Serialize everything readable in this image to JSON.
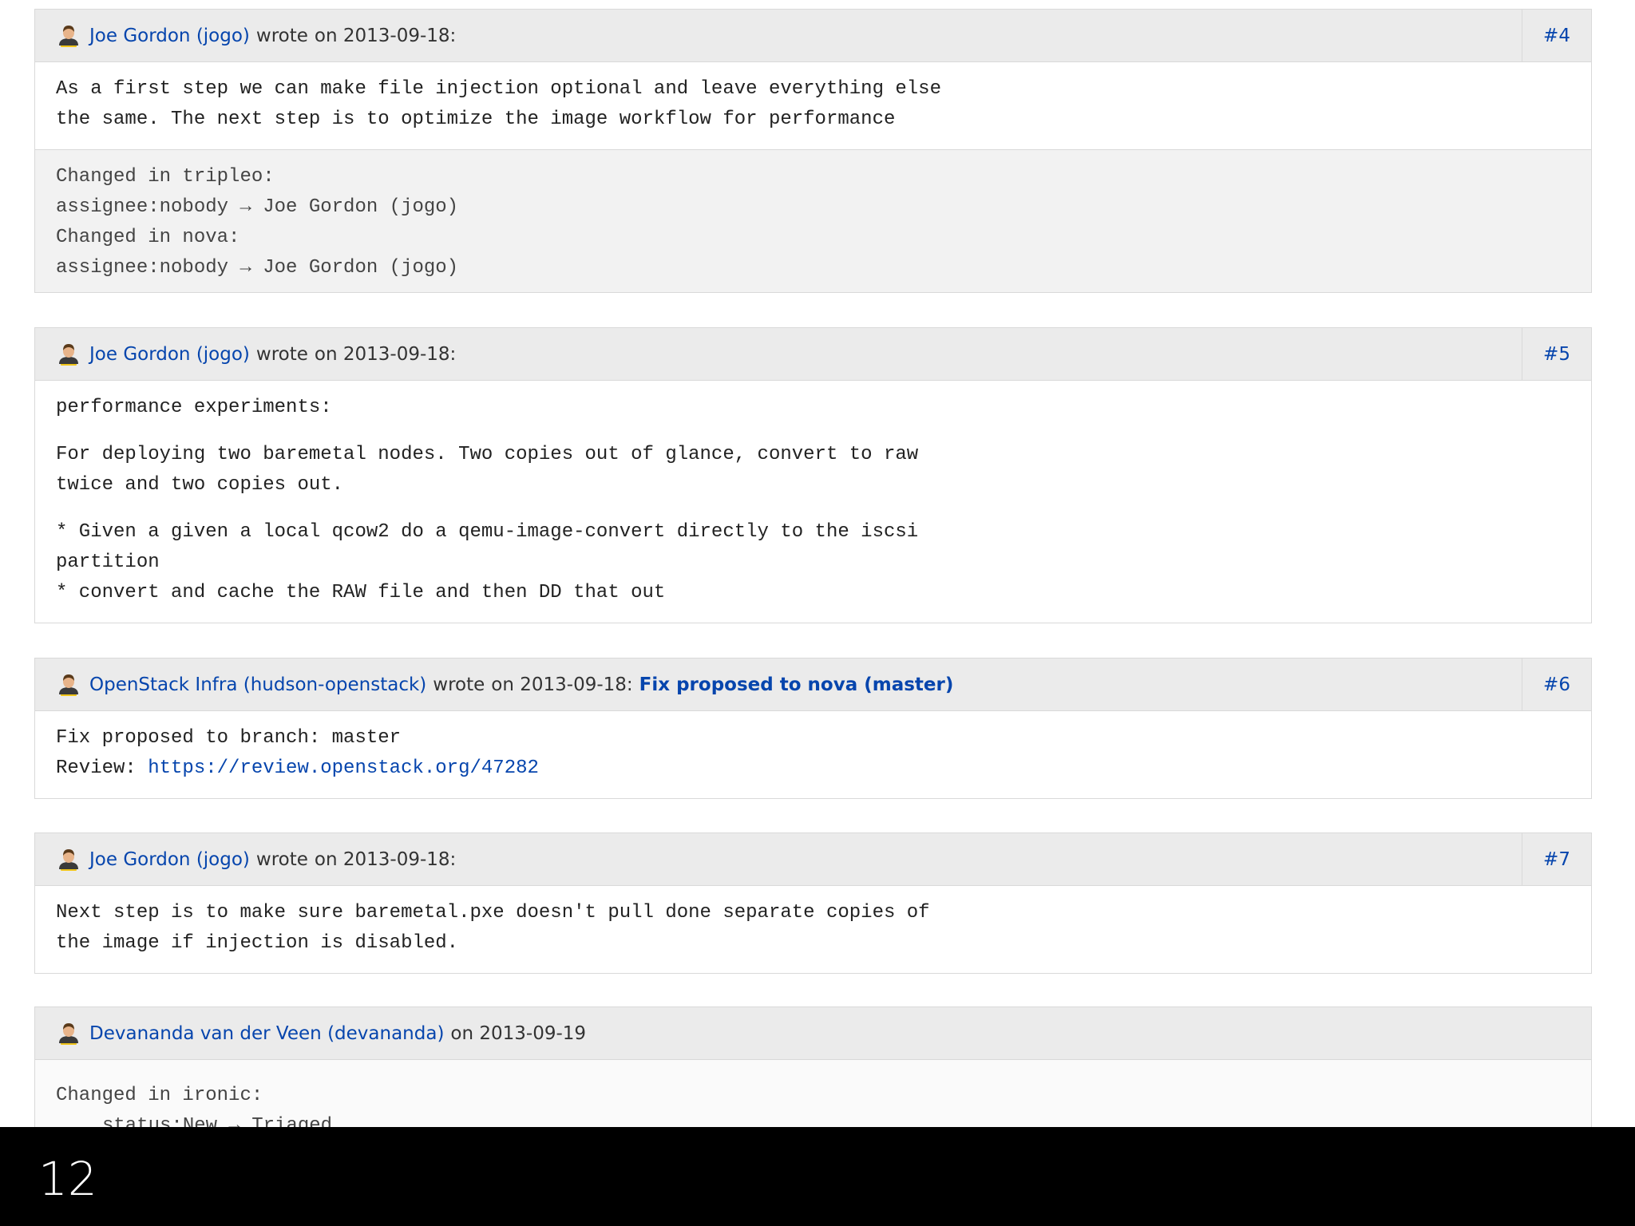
{
  "comments": [
    {
      "author": "Joe Gordon (jogo)",
      "verb": "wrote",
      "date": "on 2013-09-18:",
      "number": "#4",
      "body": [
        "As a first step we can make file injection optional and leave everything else\nthe same. The next step is to optimize the image workflow for performance"
      ],
      "activity": [
        "Changed in tripleo:",
        "assignee:nobody → Joe Gordon (jogo)",
        "Changed in nova:",
        "assignee:nobody → Joe Gordon (jogo)"
      ]
    },
    {
      "author": "Joe Gordon (jogo)",
      "verb": "wrote",
      "date": "on 2013-09-18:",
      "number": "#5",
      "body": [
        "performance experiments:",
        "For deploying two baremetal nodes. Two copies out of glance, convert to raw\ntwice and two copies out.",
        "* Given a given a local qcow2 do a qemu-image-convert directly to the iscsi\npartition\n* convert and cache the RAW file and then DD that out"
      ]
    },
    {
      "author": "OpenStack Infra (hudson-openstack)",
      "verb": "wrote",
      "date": "on 2013-09-18:",
      "title": "Fix proposed to nova (master)",
      "number": "#6",
      "body_line1": "Fix proposed to branch: master",
      "review_label": "Review: ",
      "review_url": "https://review.openstack.org/47282"
    },
    {
      "author": "Joe Gordon (jogo)",
      "verb": "wrote",
      "date": "on 2013-09-18:",
      "number": "#7",
      "body": [
        "Next step is to make sure baremetal.pxe doesn't pull done separate copies of\nthe image if injection is disabled."
      ]
    },
    {
      "author": "Devananda van der Veen (devananda)",
      "date": "on 2013-09-19",
      "activity": [
        "Changed in ironic:",
        "status:New → Triaged"
      ]
    }
  ],
  "slide_number": "12",
  "icons": {
    "person": "person-icon"
  },
  "colors": {
    "link": "#0645ad",
    "header_bg": "#ebebeb",
    "activity_bg": "#f2f2f2",
    "border": "#d9d9d9",
    "bottom_bar": "#000000"
  }
}
